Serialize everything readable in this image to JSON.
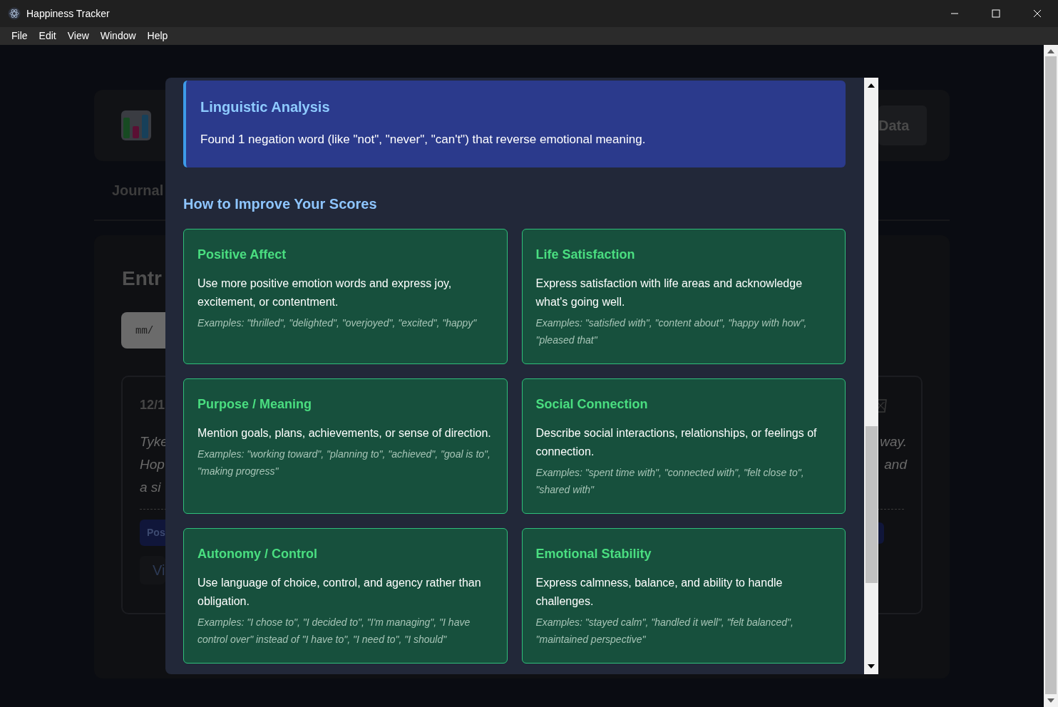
{
  "window": {
    "title": "Happiness Tracker"
  },
  "menu": [
    "File",
    "Edit",
    "View",
    "Window",
    "Help"
  ],
  "background": {
    "header_button": "Data",
    "tab": "Journal",
    "heading": "Entr",
    "date_placeholder": "mm/",
    "entry": {
      "date": "12/1",
      "text_left": [
        "Tyke",
        "Hop",
        "a si"
      ],
      "text_right": [
        "way.",
        "and"
      ],
      "badge": "Pos",
      "button": "Vi"
    }
  },
  "modal": {
    "insight": {
      "title": "Linguistic Analysis",
      "text": "Found 1 negation word (like \"not\", \"never\", \"can't\") that reverse emotional meaning."
    },
    "section_title": "How to Improve Your Scores",
    "tips": [
      {
        "title": "Positive Affect",
        "description": "Use more positive emotion words and express joy, excitement, or contentment.",
        "examples": "Examples: \"thrilled\", \"delighted\", \"overjoyed\", \"excited\", \"happy\""
      },
      {
        "title": "Life Satisfaction",
        "description": "Express satisfaction with life areas and acknowledge what's going well.",
        "examples": "Examples: \"satisfied with\", \"content about\", \"happy with how\", \"pleased that\""
      },
      {
        "title": "Purpose / Meaning",
        "description": "Mention goals, plans, achievements, or sense of direction.",
        "examples": "Examples: \"working toward\", \"planning to\", \"achieved\", \"goal is to\", \"making progress\""
      },
      {
        "title": "Social Connection",
        "description": "Describe social interactions, relationships, or feelings of connection.",
        "examples": "Examples: \"spent time with\", \"connected with\", \"felt close to\", \"shared with\""
      },
      {
        "title": "Autonomy / Control",
        "description": "Use language of choice, control, and agency rather than obligation.",
        "examples": "Examples: \"I chose to\", \"I decided to\", \"I'm managing\", \"I have control over\" instead of \"I have to\", \"I need to\", \"I should\""
      },
      {
        "title": "Emotional Stability",
        "description": "Express calmness, balance, and ability to handle challenges.",
        "examples": "Examples: \"stayed calm\", \"handled it well\", \"felt balanced\", \"maintained perspective\""
      }
    ]
  }
}
